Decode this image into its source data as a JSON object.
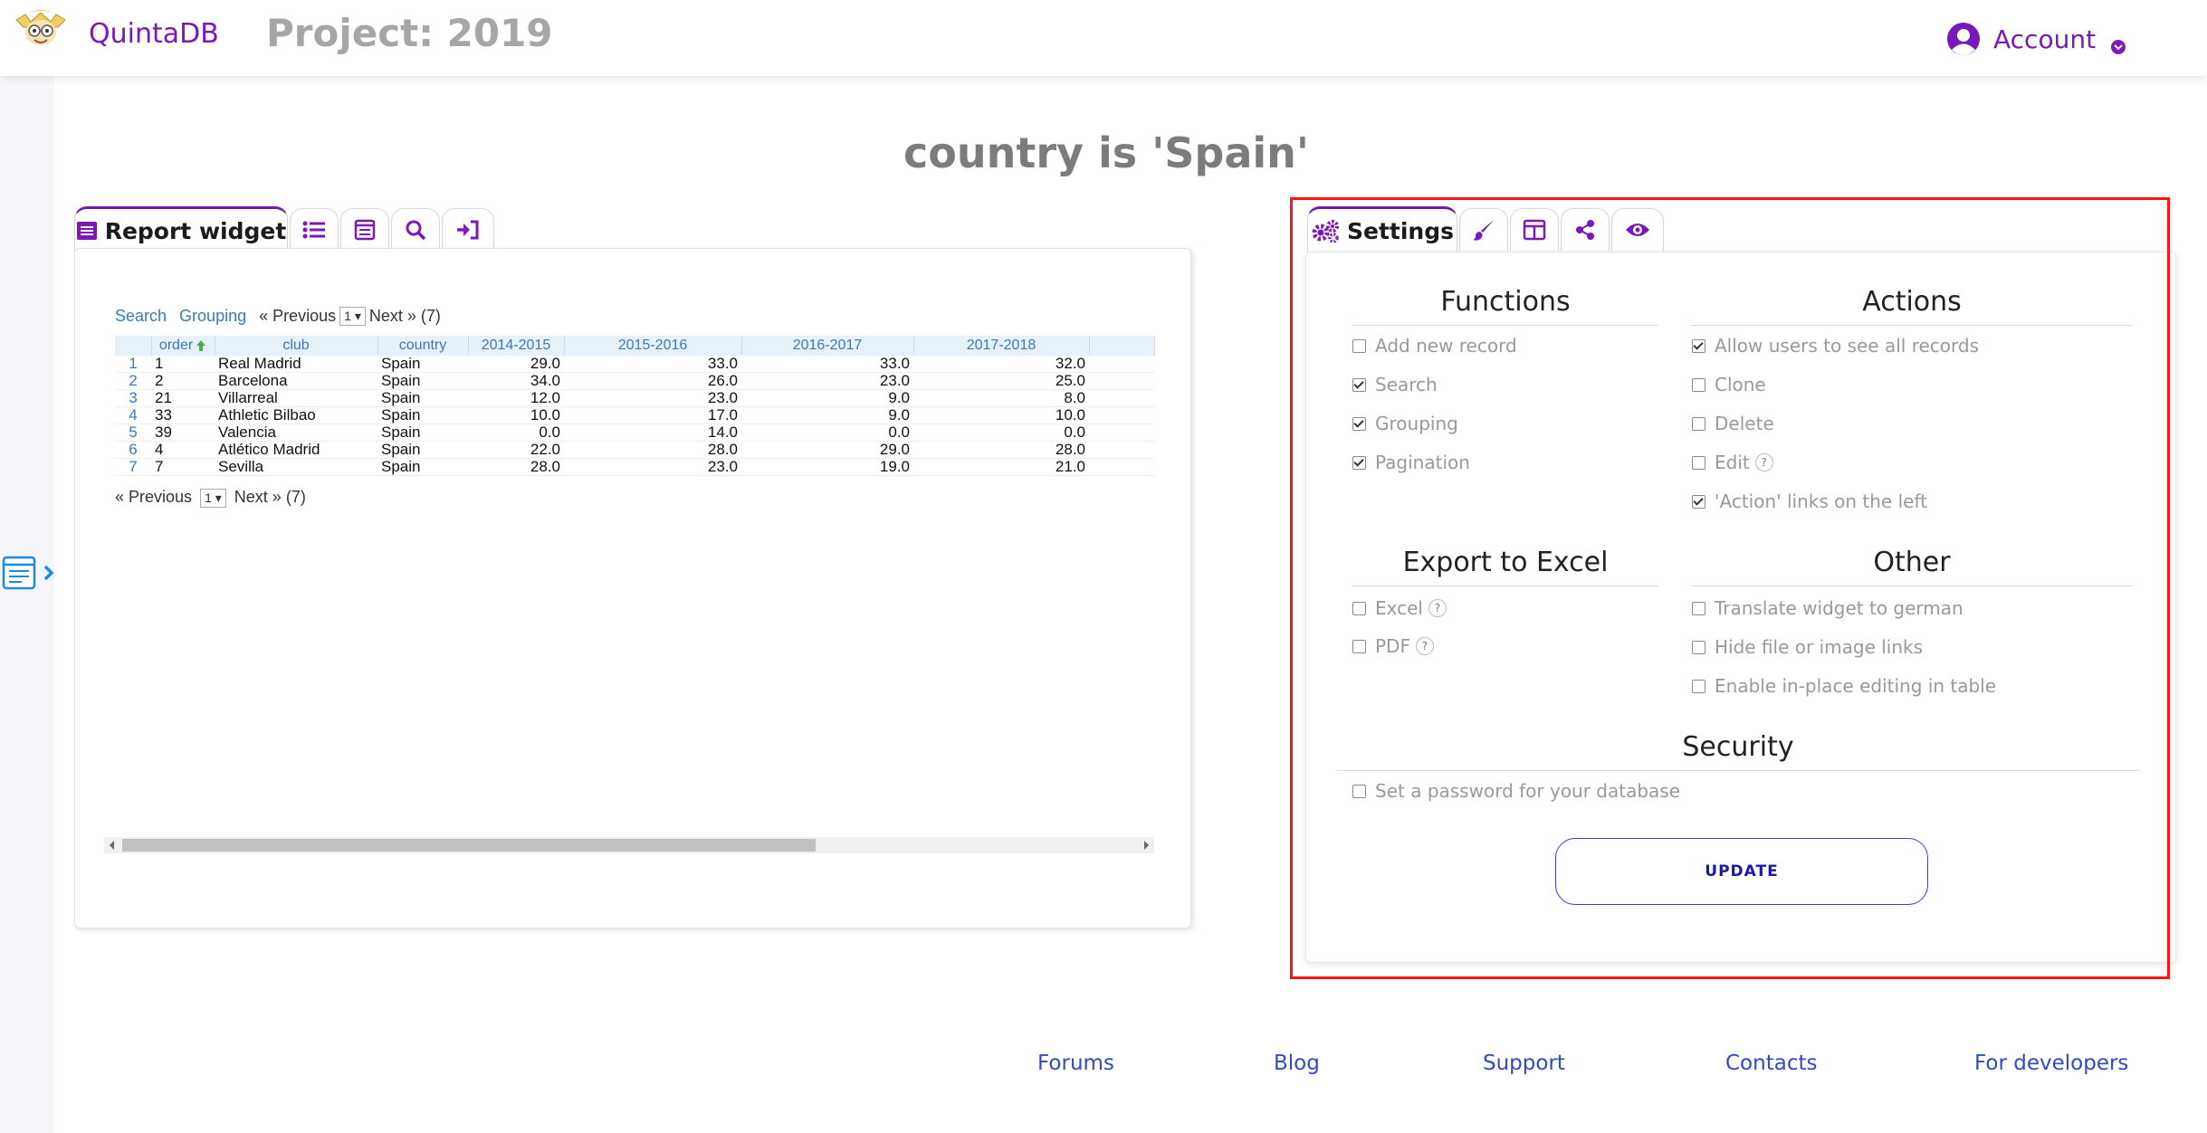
{
  "header": {
    "brand": "QuintaDB",
    "project": "Project: 2019",
    "account": "Account"
  },
  "page": {
    "title": "country is 'Spain'"
  },
  "report": {
    "tab_label": "Report widget",
    "tab_icons": [
      "list-icon",
      "form-icon",
      "search-icon",
      "sign-in-icon"
    ],
    "toolbar": {
      "search": "Search",
      "grouping": "Grouping",
      "previous": "« Previous",
      "page": "1",
      "next_count": "Next » (7)"
    },
    "columns": [
      "order",
      "club",
      "country",
      "2014-2015",
      "2015-2016",
      "2016-2017",
      "2017-2018"
    ],
    "rows": [
      [
        "1",
        "1",
        "Real Madrid",
        "Spain",
        "29.0",
        "33.0",
        "33.0",
        "32.0"
      ],
      [
        "2",
        "2",
        "Barcelona",
        "Spain",
        "34.0",
        "26.0",
        "23.0",
        "25.0"
      ],
      [
        "3",
        "21",
        "Villarreal",
        "Spain",
        "12.0",
        "23.0",
        "9.0",
        "8.0"
      ],
      [
        "4",
        "33",
        "Athletic Bilbao",
        "Spain",
        "10.0",
        "17.0",
        "9.0",
        "10.0"
      ],
      [
        "5",
        "39",
        "Valencia",
        "Spain",
        "0.0",
        "14.0",
        "0.0",
        "0.0"
      ],
      [
        "6",
        "4",
        "Atlético Madrid",
        "Spain",
        "22.0",
        "28.0",
        "29.0",
        "28.0"
      ],
      [
        "7",
        "7",
        "Sevilla",
        "Spain",
        "28.0",
        "23.0",
        "19.0",
        "21.0"
      ]
    ]
  },
  "settings": {
    "tab_label": "Settings",
    "tab_icons": [
      "brush-icon",
      "columns-icon",
      "share-icon",
      "eye-icon"
    ],
    "functions": {
      "title": "Functions",
      "items": [
        {
          "label": "Add new record",
          "checked": false
        },
        {
          "label": "Search",
          "checked": true
        },
        {
          "label": "Grouping",
          "checked": true
        },
        {
          "label": "Pagination",
          "checked": true
        }
      ]
    },
    "actions": {
      "title": "Actions",
      "items": [
        {
          "label": "Allow users to see all records",
          "checked": true
        },
        {
          "label": "Clone",
          "checked": false
        },
        {
          "label": "Delete",
          "checked": false
        },
        {
          "label": "Edit",
          "checked": false,
          "help": "?"
        },
        {
          "label": "'Action' links on the left",
          "checked": true
        }
      ]
    },
    "export": {
      "title": "Export to Excel",
      "items": [
        {
          "label": "Excel",
          "checked": false,
          "help": "?"
        },
        {
          "label": "PDF",
          "checked": false,
          "help": "?"
        }
      ]
    },
    "other": {
      "title": "Other",
      "items": [
        {
          "label": "Translate widget to german",
          "checked": false
        },
        {
          "label": "Hide file or image links",
          "checked": false
        },
        {
          "label": "Enable in-place editing in table",
          "checked": false
        }
      ]
    },
    "security": {
      "title": "Security",
      "items": [
        {
          "label": "Set a password for your database",
          "checked": false
        }
      ]
    },
    "update_label": "UPDATE"
  },
  "footer": {
    "links": [
      "Forums",
      "Blog",
      "Support",
      "Contacts",
      "For developers"
    ]
  },
  "colors": {
    "brand": "#7a18b8",
    "link": "#2f4bc0",
    "selection": "#ff1414"
  }
}
